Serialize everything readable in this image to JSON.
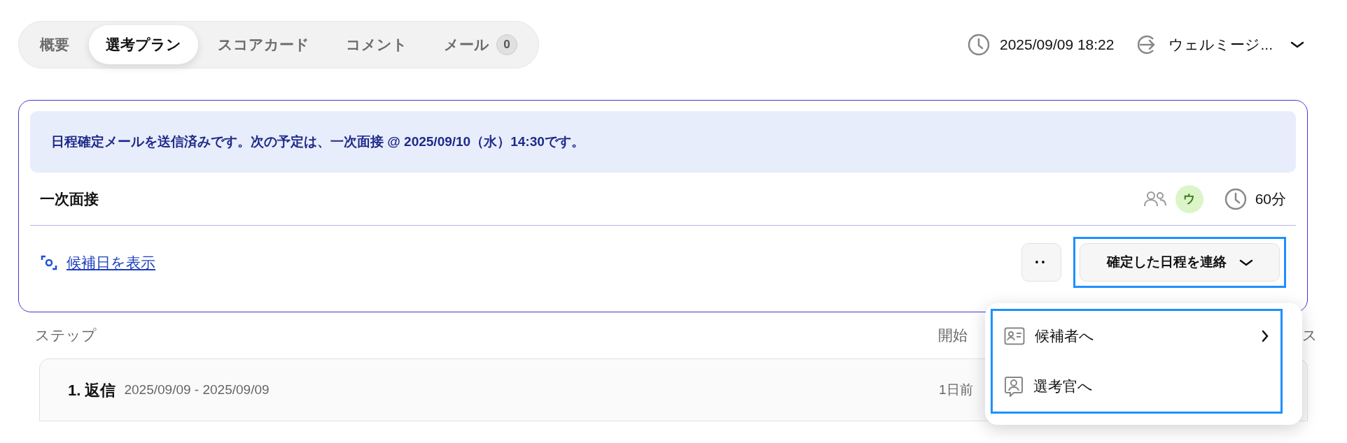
{
  "tabs": [
    {
      "label": "概要",
      "selected": false
    },
    {
      "label": "選考プラン",
      "selected": true
    },
    {
      "label": "スコアカード",
      "selected": false
    },
    {
      "label": "コメント",
      "selected": false
    },
    {
      "label": "メール",
      "selected": false,
      "badge": "0"
    }
  ],
  "header": {
    "datetime": "2025/09/09 18:22",
    "user": "ウェルミージ..."
  },
  "notice": "日程確定メールを送信済みです。次の予定は、一次面接 @ 2025/09/10（水）14:30です。",
  "stage": {
    "title": "一次面接",
    "avatar": "ウ",
    "duration": "60分",
    "link": "候補日を表示",
    "more_button": "••",
    "action_button": "確定した日程を連絡"
  },
  "menu": {
    "items": [
      {
        "label": "候補者へ",
        "kind": "submenu"
      },
      {
        "label": "選考官へ",
        "kind": "plain"
      }
    ]
  },
  "table": {
    "columns": [
      {
        "label": "ステップ"
      },
      {
        "label": "開始"
      },
      {
        "label": "ス"
      }
    ],
    "rows": [
      {
        "title": "1. 返信",
        "dates": "2025/09/09 - 2025/09/09",
        "start": "1日前"
      }
    ]
  }
}
